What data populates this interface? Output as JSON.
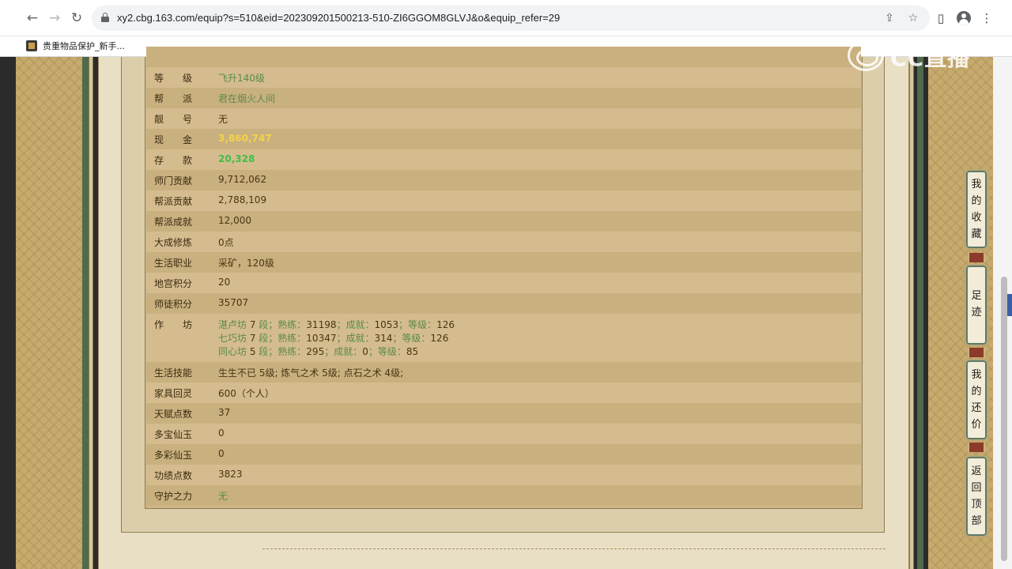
{
  "browser": {
    "url": "xy2.cbg.163.com/equip?s=510&eid=202309201500213-510-ZI6GGOM8GLVJ&o&equip_refer=29",
    "bookmark_label": "贵重物品保护_新手..."
  },
  "watermark": {
    "text": "CC直播"
  },
  "rows": [
    {
      "label": "等　　级",
      "value": "飞升140级",
      "style": "green"
    },
    {
      "label": "帮　　派",
      "value": "君在烟火人间",
      "style": "green"
    },
    {
      "label": "靓　　号",
      "value": "无",
      "style": "normal"
    },
    {
      "label": "现　　金",
      "value": "3,860,747",
      "style": "gold"
    },
    {
      "label": "存　　款",
      "value": "20,328",
      "style": "lime"
    },
    {
      "label": "师门贡献",
      "value": "9,712,062",
      "style": "normal"
    },
    {
      "label": "帮派贡献",
      "value": "2,788,109",
      "style": "normal"
    },
    {
      "label": "帮派成就",
      "value": "12,000",
      "style": "normal"
    },
    {
      "label": "大成修炼",
      "value": "0点",
      "style": "normal"
    },
    {
      "label": "生活职业",
      "value": "采矿，120级",
      "style": "normal"
    },
    {
      "label": "地宫积分",
      "value": "20",
      "style": "normal"
    },
    {
      "label": "师徒积分",
      "value": "35707",
      "style": "normal"
    }
  ],
  "workshop": {
    "label": "作　　坊",
    "lines": [
      {
        "name": "湛卢坊",
        "stage": "7",
        "proficiency": "31198",
        "achievement": "1053",
        "level": "126"
      },
      {
        "name": "七巧坊",
        "stage": "7",
        "proficiency": "10347",
        "achievement": "314",
        "level": "126"
      },
      {
        "name": "同心坊",
        "stage": "5",
        "proficiency": "295",
        "achievement": "0",
        "level": "85"
      }
    ],
    "stage_unit": "段",
    "proficiency_label": "熟练",
    "achievement_label": "成就",
    "level_label": "等级"
  },
  "rows2": [
    {
      "label": "生活技能",
      "value": "生生不已 5级; 炼气之术 5级; 点石之术 4级;",
      "style": "normal"
    },
    {
      "label": "家具回灵",
      "value": "600（个人）",
      "style": "normal"
    },
    {
      "label": "天赋点数",
      "value": "37",
      "style": "normal"
    },
    {
      "label": "多宝仙玉",
      "value": "0",
      "style": "normal"
    },
    {
      "label": "多彩仙玉",
      "value": "0",
      "style": "normal"
    },
    {
      "label": "功绩点数",
      "value": "3823",
      "style": "normal"
    },
    {
      "label": "守护之力",
      "value": "无",
      "style": "green"
    }
  ],
  "float_buttons": [
    {
      "id": "favorites",
      "text": "我的收藏"
    },
    {
      "id": "footprints",
      "text": "足迹"
    },
    {
      "id": "my-offers",
      "text": "我的还价"
    },
    {
      "id": "back-to-top",
      "text": "返回顶部"
    }
  ]
}
